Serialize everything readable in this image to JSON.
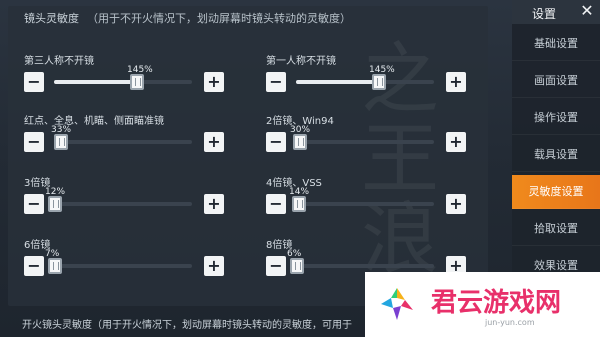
{
  "section": {
    "title": "镜头灵敏度",
    "hint": "（用于不开火情况下，划动屏幕时镜头转动的灵敏度）"
  },
  "controls": [
    {
      "label": "第三人称不开镜",
      "value": "145%",
      "percent": 0.6
    },
    {
      "label": "第一人称不开镜",
      "value": "145%",
      "percent": 0.6
    },
    {
      "label": "红点、全息、机瞄、侧面瞄准镜",
      "value": "33%",
      "percent": 0.05
    },
    {
      "label": "2倍镜、Win94",
      "value": "30%",
      "percent": 0.03
    },
    {
      "label": "3倍镜",
      "value": "12%",
      "percent": 0.01
    },
    {
      "label": "4倍镜、VSS",
      "value": "14%",
      "percent": 0.02
    },
    {
      "label": "6倍镜",
      "value": "7%",
      "percent": 0.005
    },
    {
      "label": "8倍镜",
      "value": "6%",
      "percent": 0.004
    }
  ],
  "buttons": {
    "minus": "−",
    "plus": "+"
  },
  "footer": {
    "title": "开火镜头灵敏度（用于开火情况下，划动屏幕时镜头转动的灵敏度，可用于"
  },
  "sidebar": {
    "title": "设置",
    "close": "✕",
    "items": [
      {
        "label": "基础设置"
      },
      {
        "label": "画面设置"
      },
      {
        "label": "操作设置"
      },
      {
        "label": "载具设置"
      },
      {
        "label": "灵敏度设置"
      },
      {
        "label": "拾取设置"
      },
      {
        "label": "效果设置"
      }
    ],
    "active_index": 4,
    "active_color": "#f08a1c"
  },
  "watermark": {
    "text": "之王浪"
  },
  "logo": {
    "brand": "君云游戏网",
    "sub": "jun-yun.com",
    "color": "#e8306a"
  }
}
